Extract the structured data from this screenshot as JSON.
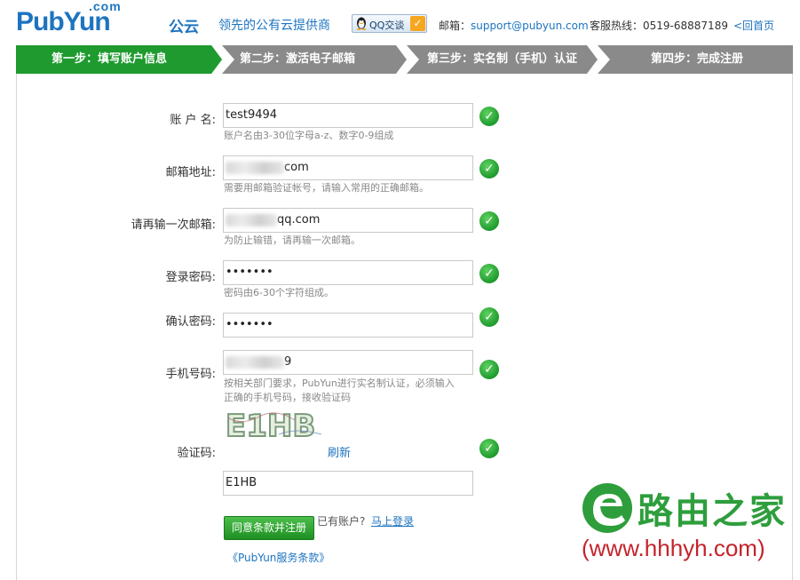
{
  "header": {
    "logo_dotcom": ".com",
    "logo_text": "PubYun",
    "logo_cn": "公云",
    "slogan": "领先的公有云提供商",
    "qq_label": "QQ交谈",
    "email_label": "邮箱：",
    "email": "support@pubyun.com",
    "hotline_label": "客服热线：",
    "hotline": "0519-68887189",
    "back_home": "<回首页"
  },
  "steps": [
    {
      "label": "第一步：填写账户信息",
      "active": true
    },
    {
      "label": "第二步：激活电子邮箱",
      "active": false
    },
    {
      "label": "第三步：实名制（手机）认证",
      "active": false
    },
    {
      "label": "第四步：完成注册",
      "active": false
    }
  ],
  "form": {
    "account": {
      "label": "账 户 名:",
      "value": "test9494",
      "hint": "账户名由3-30位字母a-z、数字0-9组成"
    },
    "email": {
      "label": "邮箱地址:",
      "value_suffix": "com",
      "hint": "需要用邮箱验证帐号，请输入常用的正确邮箱。"
    },
    "email_confirm": {
      "label": "请再输一次邮箱:",
      "value_suffix": "qq.com",
      "hint": "为防止输错，请再输一次邮箱。"
    },
    "password": {
      "label": "登录密码:",
      "value": "•••••••",
      "hint": "密码由6-30个字符组成。"
    },
    "password_confirm": {
      "label": "确认密码:",
      "value": "•••••••"
    },
    "phone": {
      "label": "手机号码:",
      "value_suffix": "9",
      "hint_line1": "按相关部门要求，PubYun进行实名制认证，必须输入",
      "hint_line2": "正确的手机号码，接收验证码"
    },
    "captcha": {
      "label": "验证码:",
      "image_text": "E1HB",
      "refresh": "刷新",
      "value": "E1HB"
    },
    "submit_label": "同意条款并注册",
    "have_account": "已有账户?",
    "login_link": "马上登录",
    "terms_link": "《PubYun服务条款》"
  },
  "watermark": {
    "cn": "路由之家",
    "url": "(www.hhhyh.com)"
  },
  "colors": {
    "brand_blue": "#1d74c0",
    "step_active": "#1e9a2e",
    "step_inactive": "#8a8a8a",
    "ok_green": "#2aa83a",
    "watermark_green": "#2e9e3c",
    "watermark_red": "#c4232b"
  },
  "icons": {
    "valid": "check-circle-icon",
    "qq": "qq-penguin-icon"
  }
}
